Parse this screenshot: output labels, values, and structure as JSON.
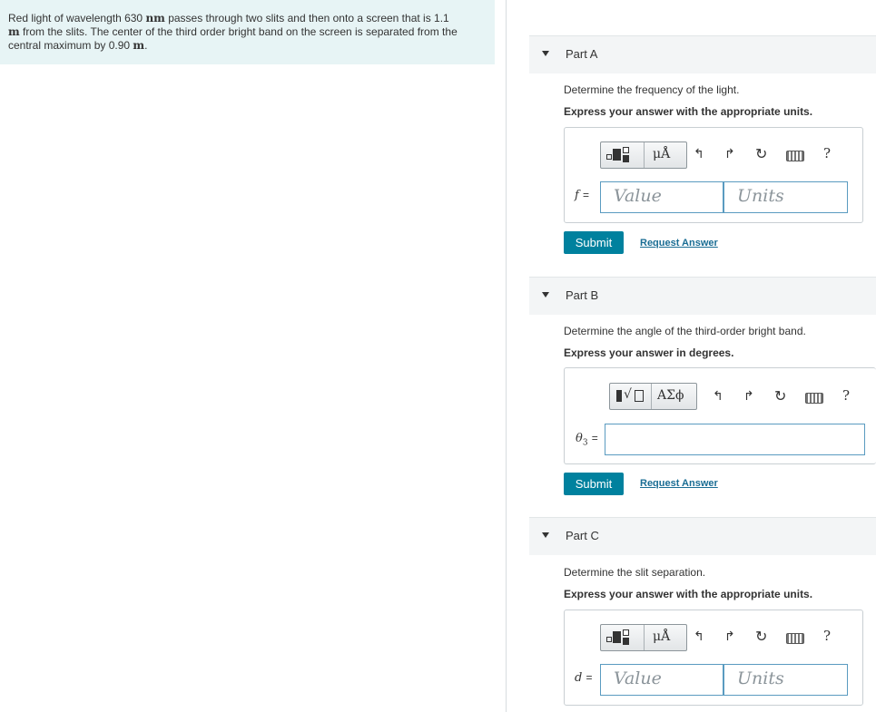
{
  "problem": {
    "text_part1": "Red light of wavelength 630 ",
    "unit_nm": "nm",
    "text_part2": " passes through two slits and then onto a screen that is 1.1 ",
    "unit_m1": "m",
    "text_part3": " from the slits. The center of the third order bright band on the screen is separated from the central maximum by 0.90 ",
    "unit_m2": "m",
    "text_part4": "."
  },
  "parts": [
    {
      "title": "Part A",
      "question": "Determine the frequency of the light.",
      "instruction": "Express your answer with the appropriate units.",
      "toolbar": {
        "template_group_label": "μÅ",
        "help": "?"
      },
      "variable": "f",
      "equals": "=",
      "value_placeholder": "Value",
      "units_placeholder": "Units",
      "submit_label": "Submit",
      "request_label": "Request Answer"
    },
    {
      "title": "Part B",
      "question": "Determine the angle of the third-order bright band.",
      "instruction": "Express your answer in degrees.",
      "toolbar": {
        "template_group_label": "ΑΣϕ",
        "help": "?"
      },
      "variable": "θ",
      "variable_subscript": "3",
      "equals": "=",
      "submit_label": "Submit",
      "request_label": "Request Answer"
    },
    {
      "title": "Part C",
      "question": "Determine the slit separation.",
      "instruction": "Express your answer with the appropriate units.",
      "toolbar": {
        "template_group_label": "μÅ",
        "help": "?"
      },
      "variable": "d",
      "equals": "=",
      "value_placeholder": "Value",
      "units_placeholder": "Units"
    }
  ]
}
